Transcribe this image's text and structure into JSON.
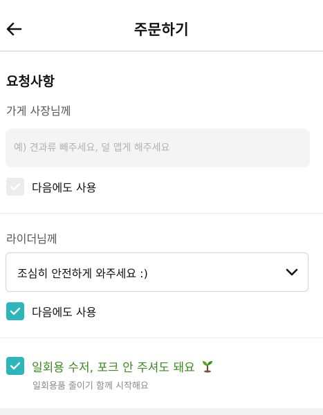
{
  "header": {
    "title": "주문하기",
    "back_icon": "arrow-left-icon"
  },
  "request": {
    "section_title": "요청사항",
    "store_owner": {
      "label": "가게 사장님께",
      "placeholder": "예) 견과류 빼주세요, 덜 맵게 해주세요",
      "value": "",
      "reuse_label": "다음에도 사용",
      "reuse_checked": false
    },
    "rider": {
      "label": "라이더님께",
      "selected": "조심히 안전하게 와주세요 :)",
      "reuse_label": "다음에도 사용",
      "reuse_checked": true
    },
    "disposables": {
      "label": "일회용 수저, 포크 안 주셔도 돼요",
      "hint": "일회용품 줄이기 함께 시작해요",
      "checked": true,
      "icon": "sprout-icon"
    }
  },
  "colors": {
    "accent": "#2ab6ba",
    "green_text": "#3a8a1e",
    "checkbox_off": "#ececec"
  }
}
